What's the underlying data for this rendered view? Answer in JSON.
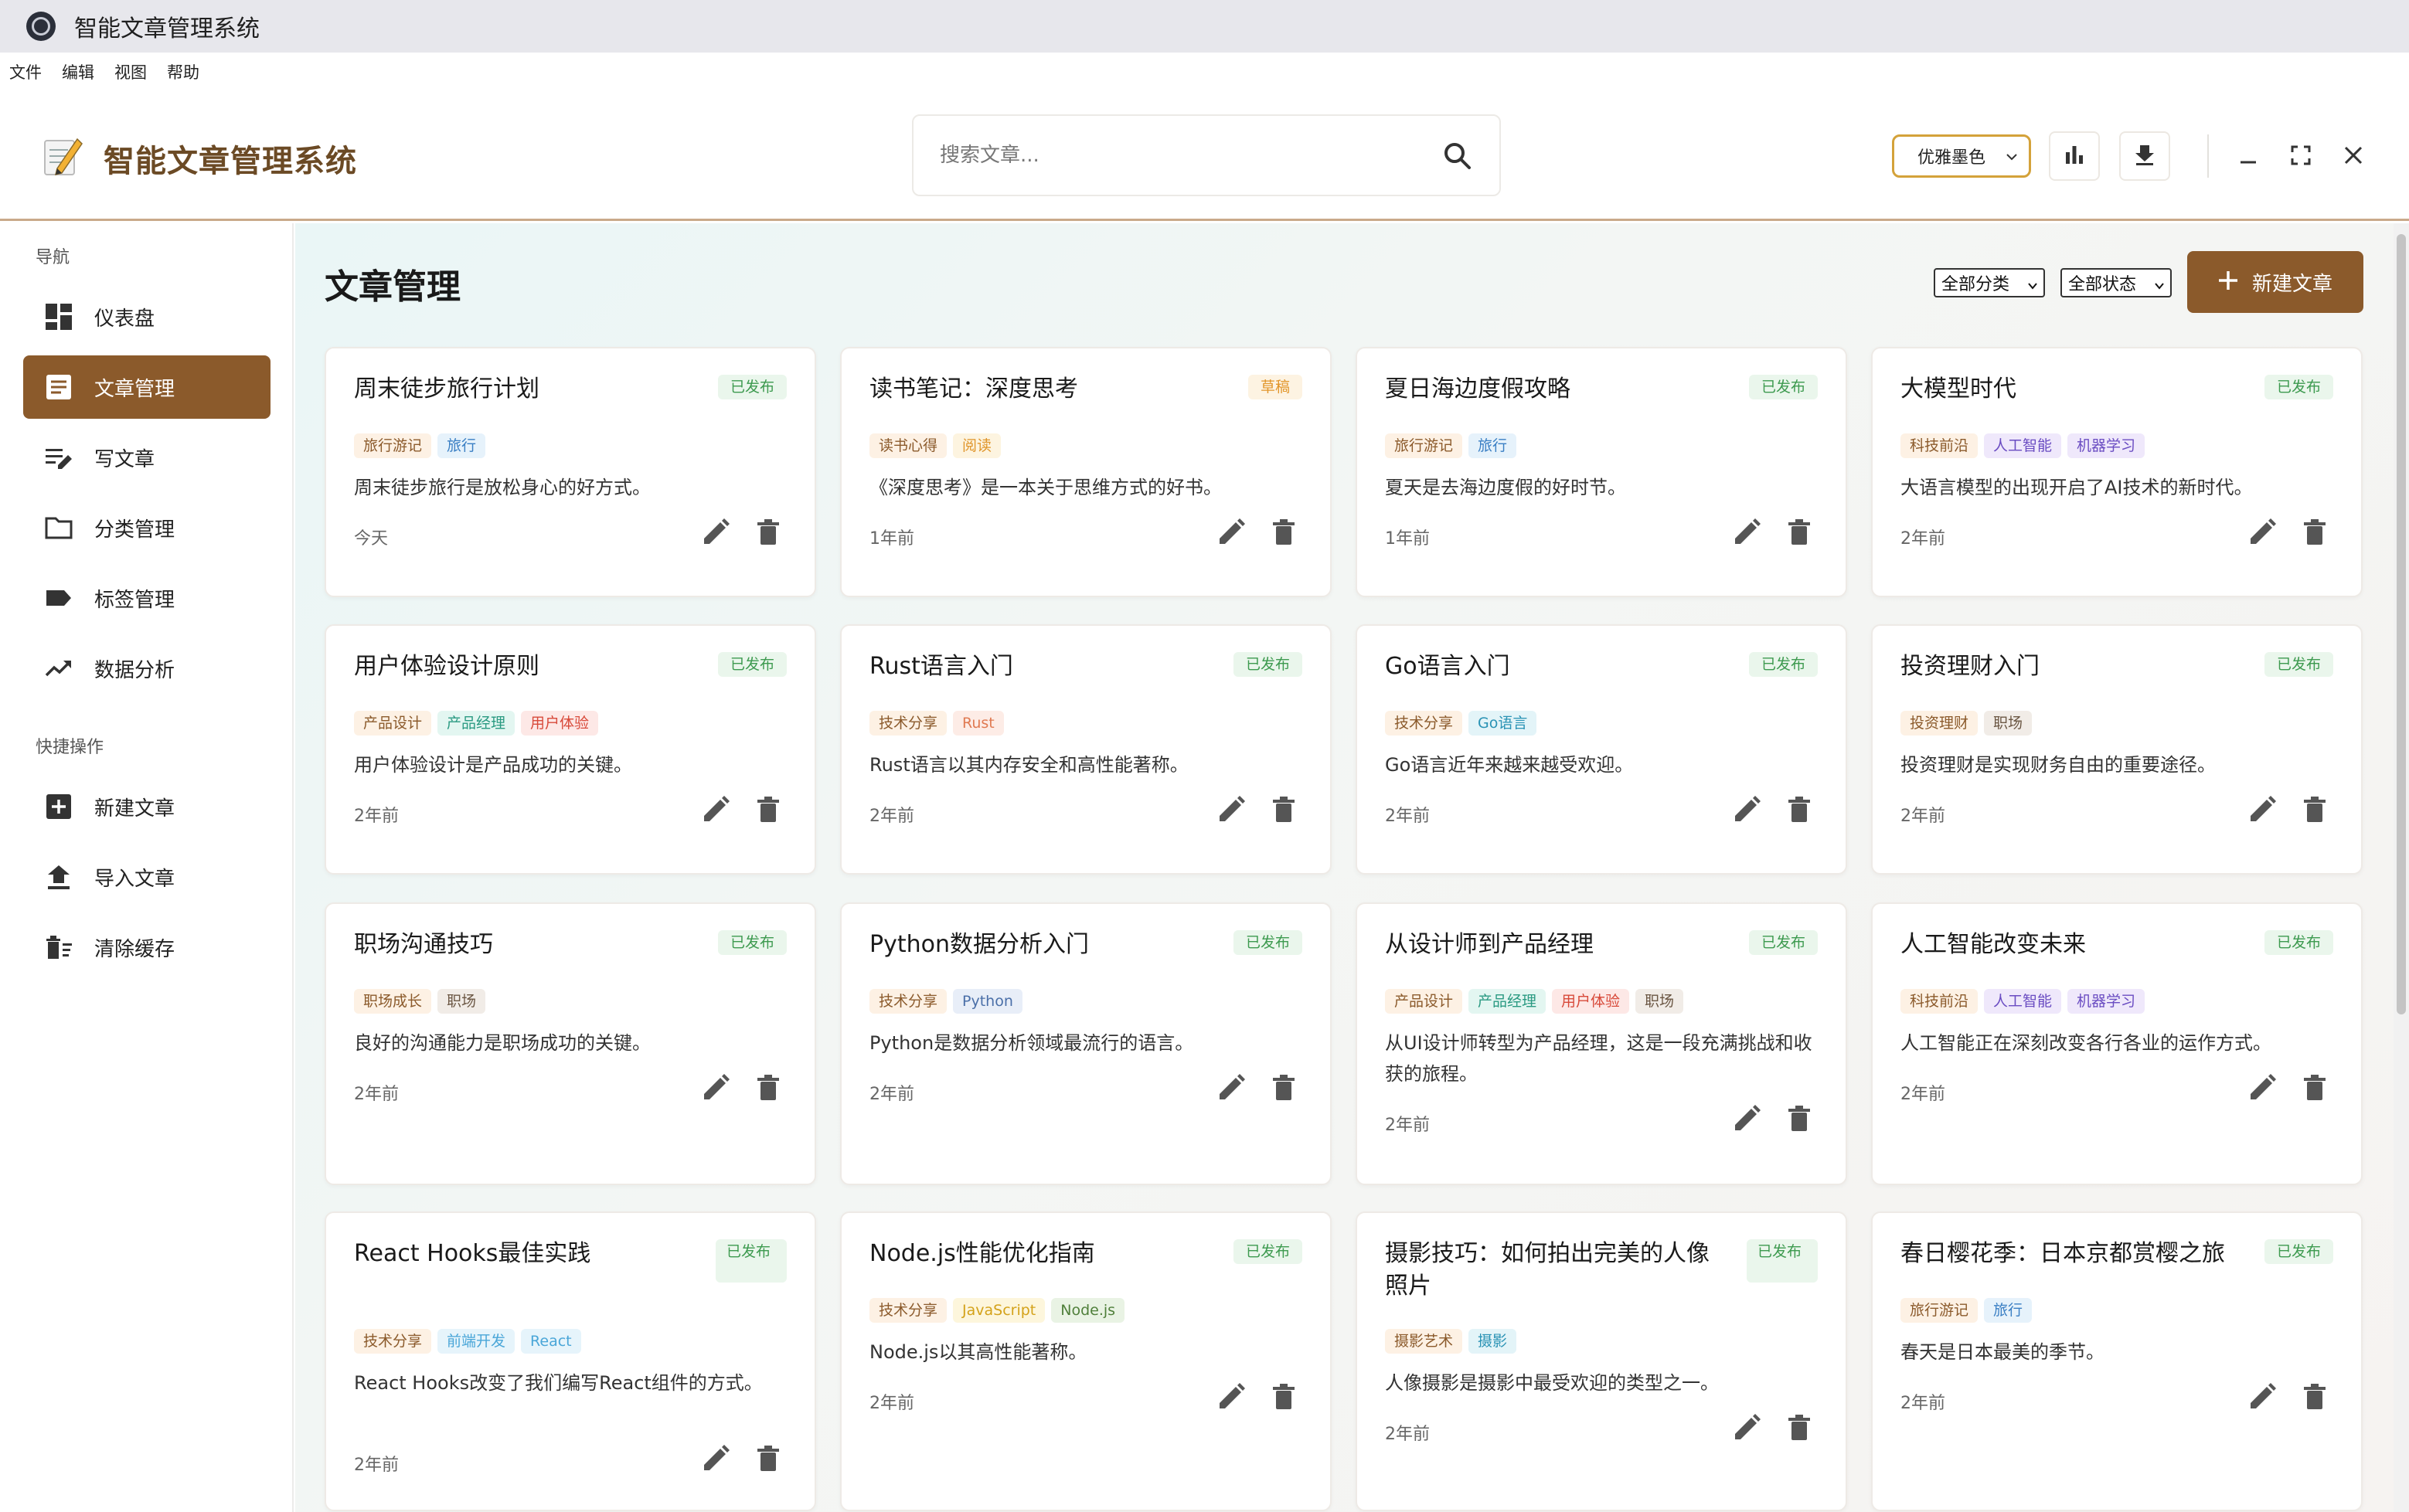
{
  "os": {
    "title": "智能文章管理系统"
  },
  "menu": [
    "文件",
    "编辑",
    "视图",
    "帮助"
  ],
  "header": {
    "logo_text": "智能文章管理系统",
    "search_placeholder": "搜索文章...",
    "theme": "优雅墨色"
  },
  "sidebar": {
    "nav_title": "导航",
    "nav_items": [
      {
        "label": "仪表盘",
        "icon": "dashboard-icon"
      },
      {
        "label": "文章管理",
        "icon": "article-icon",
        "active": true
      },
      {
        "label": "写文章",
        "icon": "edit-note-icon"
      },
      {
        "label": "分类管理",
        "icon": "folder-icon"
      },
      {
        "label": "标签管理",
        "icon": "label-icon"
      },
      {
        "label": "数据分析",
        "icon": "trending-icon"
      }
    ],
    "quick_title": "快捷操作",
    "quick_items": [
      {
        "label": "新建文章",
        "icon": "add-box-icon"
      },
      {
        "label": "导入文章",
        "icon": "upload-icon"
      },
      {
        "label": "清除缓存",
        "icon": "clear-cache-icon"
      }
    ]
  },
  "main": {
    "title": "文章管理",
    "filter_category": "全部分类",
    "filter_status": "全部状态",
    "new_button": "新建文章"
  },
  "colors": {
    "accent": "#8b5a2b",
    "published": "#3d9a4f",
    "draft": "#e2962b"
  },
  "articles": [
    {
      "title": "周末徒步旅行计划",
      "status": "已发布",
      "tags": [
        "旅行游记",
        "旅行"
      ],
      "summary": "周末徒步旅行是放松身心的好方式。",
      "time": "今天"
    },
    {
      "title": "读书笔记：深度思考",
      "status": "草稿",
      "tags": [
        "读书心得",
        "阅读"
      ],
      "summary": "《深度思考》是一本关于思维方式的好书。",
      "time": "1年前"
    },
    {
      "title": "夏日海边度假攻略",
      "status": "已发布",
      "tags": [
        "旅行游记",
        "旅行"
      ],
      "summary": "夏天是去海边度假的好时节。",
      "time": "1年前"
    },
    {
      "title": "大模型时代",
      "status": "已发布",
      "tags": [
        "科技前沿",
        "人工智能",
        "机器学习"
      ],
      "summary": "大语言模型的出现开启了AI技术的新时代。",
      "time": "2年前"
    },
    {
      "title": "用户体验设计原则",
      "status": "已发布",
      "tags": [
        "产品设计",
        "产品经理",
        "用户体验"
      ],
      "summary": "用户体验设计是产品成功的关键。",
      "time": "2年前"
    },
    {
      "title": "Rust语言入门",
      "status": "已发布",
      "tags": [
        "技术分享",
        "Rust"
      ],
      "summary": "Rust语言以其内存安全和高性能著称。",
      "time": "2年前"
    },
    {
      "title": "Go语言入门",
      "status": "已发布",
      "tags": [
        "技术分享",
        "Go语言"
      ],
      "summary": "Go语言近年来越来越受欢迎。",
      "time": "2年前"
    },
    {
      "title": "投资理财入门",
      "status": "已发布",
      "tags": [
        "投资理财",
        "职场"
      ],
      "summary": "投资理财是实现财务自由的重要途径。",
      "time": "2年前"
    },
    {
      "title": "职场沟通技巧",
      "status": "已发布",
      "tags": [
        "职场成长",
        "职场"
      ],
      "summary": "良好的沟通能力是职场成功的关键。",
      "time": "2年前"
    },
    {
      "title": "Python数据分析入门",
      "status": "已发布",
      "tags": [
        "技术分享",
        "Python"
      ],
      "summary": "Python是数据分析领域最流行的语言。",
      "time": "2年前"
    },
    {
      "title": "从设计师到产品经理",
      "status": "已发布",
      "tags": [
        "产品设计",
        "产品经理",
        "用户体验",
        "职场"
      ],
      "summary": "从UI设计师转型为产品经理，这是一段充满挑战和收获的旅程。",
      "time": "2年前"
    },
    {
      "title": "人工智能改变未来",
      "status": "已发布",
      "tags": [
        "科技前沿",
        "人工智能",
        "机器学习"
      ],
      "summary": "人工智能正在深刻改变各行各业的运作方式。",
      "time": "2年前"
    },
    {
      "title": "React Hooks最佳实践",
      "status": "已发布",
      "tags": [
        "技术分享",
        "前端开发",
        "React"
      ],
      "summary": "React Hooks改变了我们编写React组件的方式。",
      "time": "2年前"
    },
    {
      "title": "Node.js性能优化指南",
      "status": "已发布",
      "tags": [
        "技术分享",
        "JavaScript",
        "Node.js"
      ],
      "summary": "Node.js以其高性能著称。",
      "time": "2年前"
    },
    {
      "title": "摄影技巧：如何拍出完美的人像照片",
      "status": "已发布",
      "tags": [
        "摄影艺术",
        "摄影"
      ],
      "summary": "人像摄影是摄影中最受欢迎的类型之一。",
      "time": "2年前"
    },
    {
      "title": "春日樱花季：日本京都赏樱之旅",
      "status": "已发布",
      "tags": [
        "旅行游记",
        "旅行"
      ],
      "summary": "春天是日本最美的季节。",
      "time": "2年前"
    }
  ]
}
